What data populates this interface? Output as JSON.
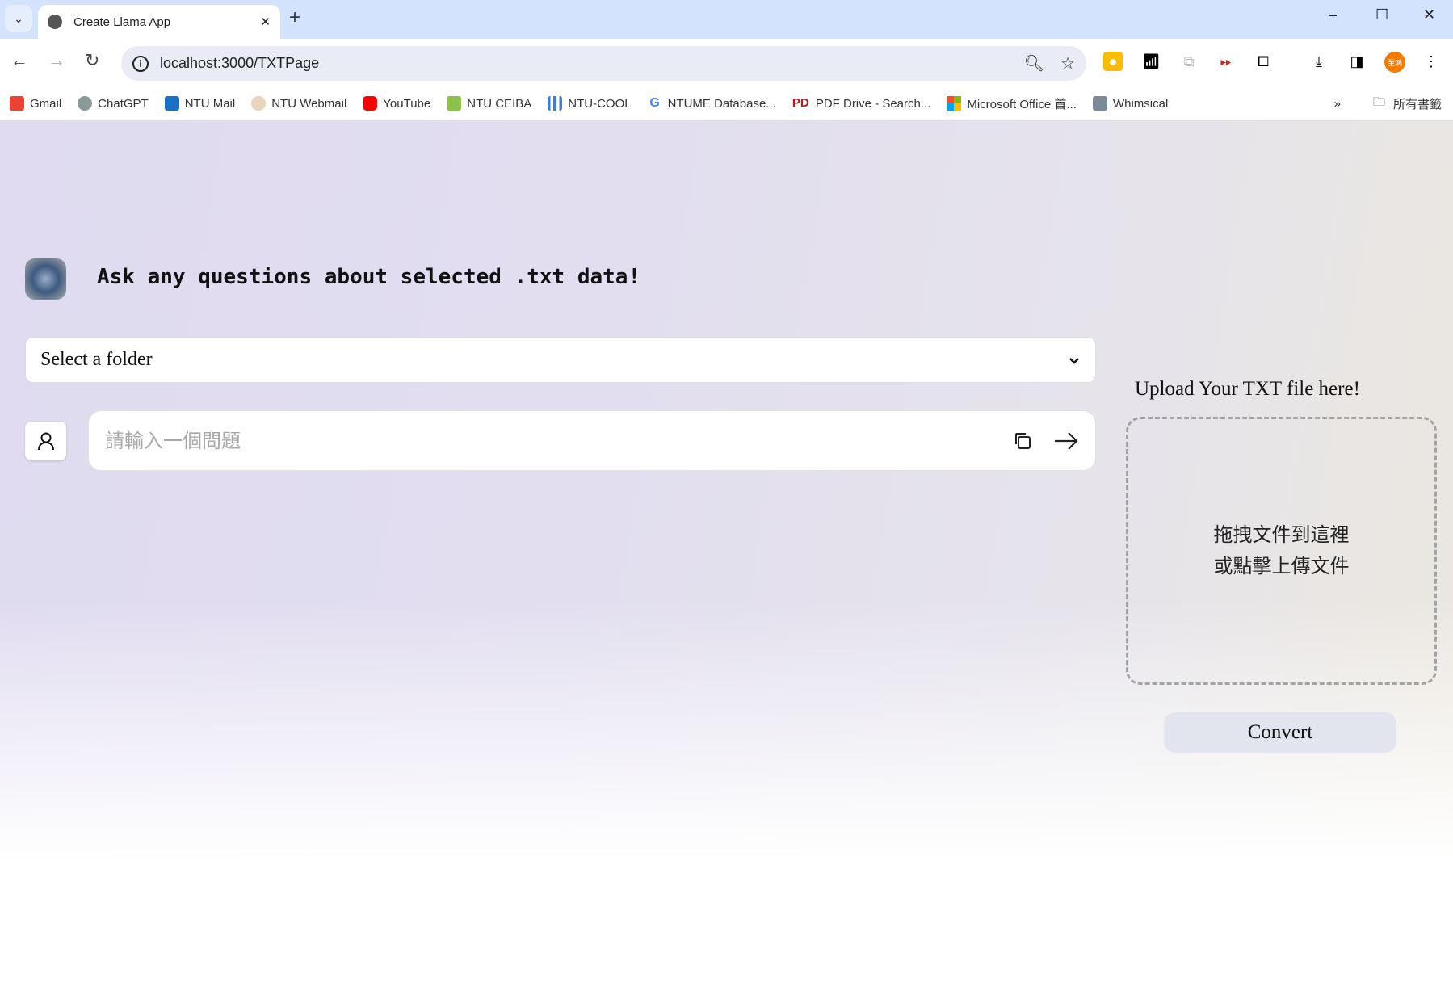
{
  "browser": {
    "tab_title": "Create Llama App",
    "url": "localhost:3000/TXTPage",
    "bookmarks": [
      {
        "label": "Gmail",
        "color": "#ea4335"
      },
      {
        "label": "ChatGPT",
        "color": "#8a9a9a"
      },
      {
        "label": "NTU Mail",
        "color": "#1a6fc9"
      },
      {
        "label": "NTU Webmail",
        "color": "#c8a27a"
      },
      {
        "label": "YouTube",
        "color": "#ff0000"
      },
      {
        "label": "NTU CEIBA",
        "color": "#8bc34a"
      },
      {
        "label": "NTU-COOL",
        "color": "#3b7dd8"
      },
      {
        "label": "NTUME Database...",
        "color": "#4285f4"
      },
      {
        "label": "PDF Drive - Search...",
        "color": "#b71c1c"
      },
      {
        "label": "Microsoft Office 首...",
        "color": "#f25022"
      },
      {
        "label": "Whimsical",
        "color": "#7a8a99"
      }
    ],
    "all_bookmarks_label": "所有書籤",
    "profile_label": "至鴻",
    "profile_color": "#f57c00"
  },
  "app": {
    "heading": "Ask any questions about selected .txt data!",
    "folder_select": {
      "selected": "Select a folder"
    },
    "question_input": {
      "placeholder": "請輸入一個問題",
      "value": ""
    },
    "upload": {
      "label": "Upload Your TXT file here!",
      "drop_line1": "拖拽文件到這裡",
      "drop_line2": "或點擊上傳文件",
      "convert_label": "Convert"
    }
  }
}
